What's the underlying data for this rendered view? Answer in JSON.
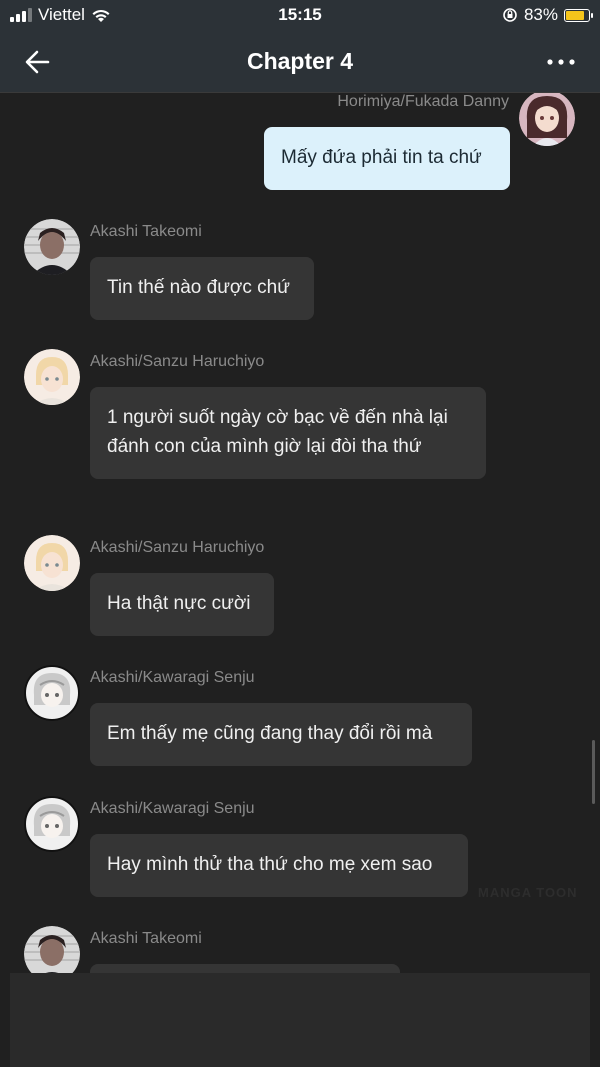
{
  "status_bar": {
    "carrier": "Viettel",
    "time": "15:15",
    "battery_percent": "83%",
    "battery_level": 0.83,
    "battery_color": "#f5c51b",
    "signal_bars": 3
  },
  "header": {
    "title": "Chapter 4",
    "back_icon": "arrow-left-icon",
    "more_icon": "more-dots-icon"
  },
  "messages": [
    {
      "sender": "Horimiya/Fukada Danny",
      "text": "Mấy đứa phải tin ta chứ",
      "side": "right"
    },
    {
      "sender": "Akashi Takeomi",
      "text": "Tin thế nào được chứ",
      "side": "left"
    },
    {
      "sender": "Akashi/Sanzu Haruchiyo",
      "text": "1 người suốt ngày cờ bạc về đến nhà lại đánh con của mình giờ lại đòi tha thứ",
      "side": "left"
    },
    {
      "sender": "Akashi/Sanzu Haruchiyo",
      "text": "Ha thật nực cười",
      "side": "left"
    },
    {
      "sender": "Akashi/Kawaragi Senju",
      "text": "Em thấy mẹ cũng đang thay đổi rồi mà",
      "side": "left"
    },
    {
      "sender": "Akashi/Kawaragi Senju",
      "text": "Hay mình thử tha thứ cho mẹ xem sao",
      "side": "left"
    },
    {
      "sender": "Akashi Takeomi",
      "text": "",
      "side": "left"
    }
  ],
  "watermark": "MANGA TOON",
  "colors": {
    "background": "#202020",
    "bubble_incoming": "#353535",
    "bubble_outgoing": "#dcf1fb",
    "sender_name": "#8a8a8a"
  }
}
